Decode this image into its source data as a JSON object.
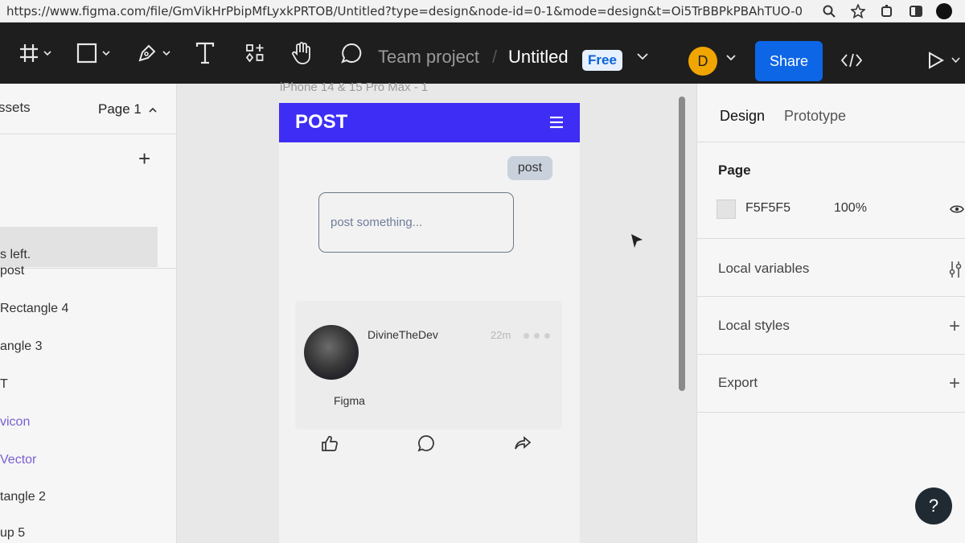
{
  "browser": {
    "url": "https://www.figma.com/file/GmVikHrPbipMfLyxkPRTOB/Untitled?type=design&node-id=0-1&mode=design&t=Oi5TrBBPkPBAhTUO-0"
  },
  "toolbar": {
    "team": "Team project",
    "title": "Untitled",
    "plan_badge": "Free",
    "avatar_initial": "D",
    "share_label": "Share",
    "tools": [
      "frame-icon",
      "rectangle-icon",
      "pen-icon",
      "text-icon",
      "components-icon",
      "hand-icon",
      "comment-icon"
    ]
  },
  "left_panel": {
    "assets_label": "ssets",
    "page_label": "Page 1",
    "status_text": "s left.",
    "layers": [
      "post",
      "Rectangle 4",
      "angle 3",
      "T",
      "vicon",
      "Vector",
      "tangle 2",
      "up 5"
    ]
  },
  "canvas": {
    "frame_label": "iPhone 14 & 15 Pro Max - 1",
    "app": {
      "title": "POST",
      "post_button": "post",
      "input_placeholder": "post something...",
      "card": {
        "author": "DivineTheDev",
        "time": "22m",
        "text": "Figma"
      }
    }
  },
  "right_panel": {
    "tab_design": "Design",
    "tab_prototype": "Prototype",
    "page_heading": "Page",
    "page_color": "F5F5F5",
    "page_opacity": "100%",
    "local_variables": "Local variables",
    "local_styles": "Local styles",
    "export": "Export"
  },
  "help_label": "?",
  "colors": {
    "toolbar_bg": "#1e1e1e",
    "share_blue": "#0d66e6",
    "app_header": "#3d2df5",
    "avatar_orange": "#f0a500"
  }
}
